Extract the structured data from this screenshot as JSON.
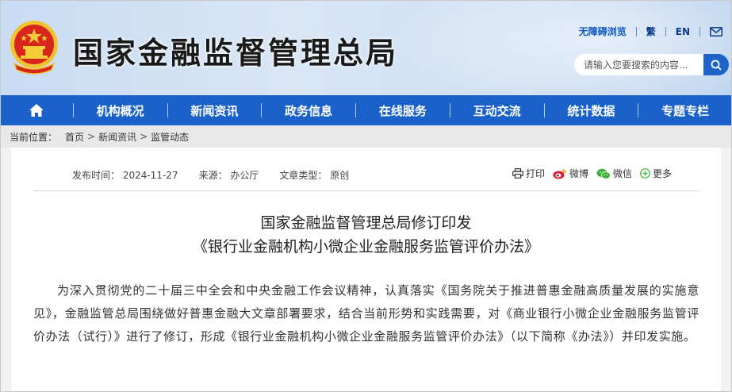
{
  "header": {
    "site_title": "国家金融监督管理总局",
    "accessibility": "无障碍浏览",
    "traditional": "繁",
    "english": "EN",
    "search_placeholder": "请输入您要搜索的内容...",
    "icons": {
      "emblem": "national-emblem-icon",
      "mail": "mail-icon",
      "search": "search-icon"
    }
  },
  "nav": {
    "home_icon": "home-icon",
    "items": [
      "机构概况",
      "新闻资讯",
      "政务信息",
      "在线服务",
      "互动交流",
      "统计数据",
      "专题专栏"
    ]
  },
  "breadcrumb": {
    "label": "当前位置：",
    "items": [
      "首页",
      "新闻资讯",
      "监管动态"
    ],
    "separator": ">"
  },
  "article": {
    "publish_time": "发布时间：  2024-11-27",
    "source": "来源：  办公厅",
    "type": "文章类型：  原创",
    "share": {
      "print": "打印",
      "weibo": "微博",
      "wechat": "微信",
      "more": "更多"
    },
    "title_line1": "国家金融监督管理总局修订印发",
    "title_line2": "《银行业金融机构小微企业金融服务监管评价办法》",
    "body": "为深入贯彻党的二十届三中全会和中央金融工作会议精神，认真落实《国务院关于推进普惠金融高质量发展的实施意见》，金融监管总局围绕做好普惠金融大文章部署要求，结合当前形势和实践需要，对《商业银行小微企业金融服务监管评价办法（试行）》进行了修订，形成《银行业金融机构小微企业金融服务监管评价办法》（以下简称《办法》）并印发实施。"
  },
  "colors": {
    "nav_bg": "#1a62c9",
    "title_text": "#1a1a1a",
    "link_blue": "#0b3b8c",
    "breadcrumb_bg": "#e8e8e8"
  }
}
